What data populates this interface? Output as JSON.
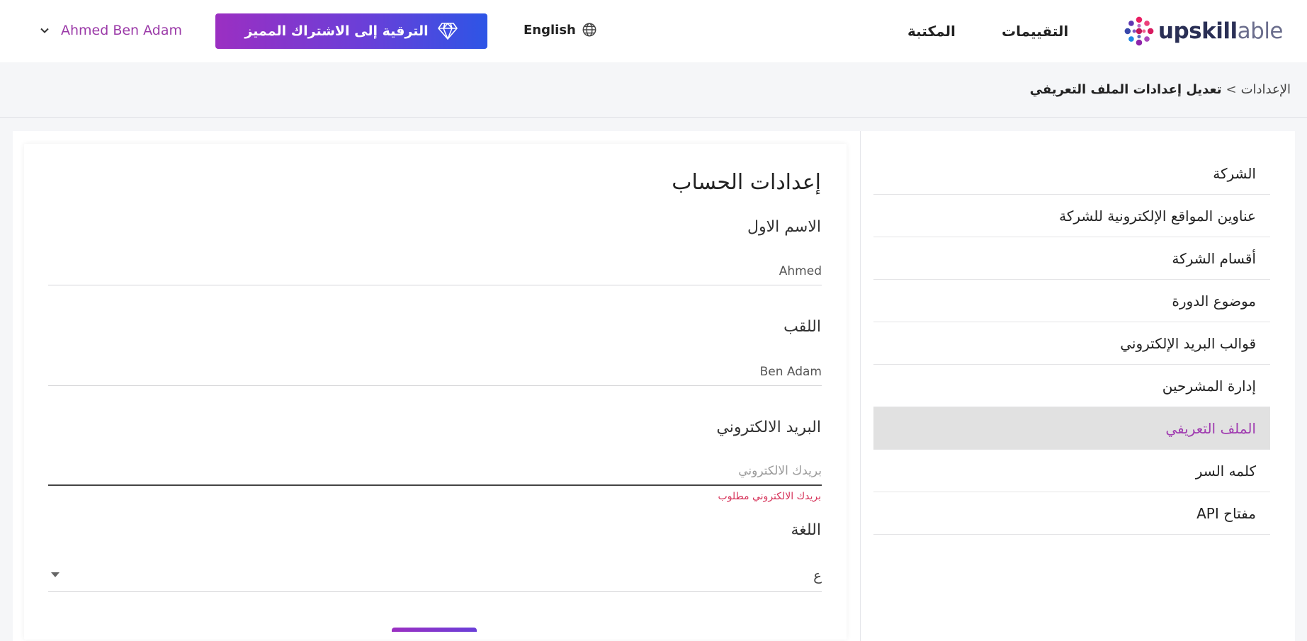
{
  "header": {
    "logo": {
      "text_bold": "upskill",
      "text_light": "able",
      "icon": "upskillable-logo-icon"
    },
    "nav": {
      "assessments": "التقييمات",
      "library": "المكتبة"
    },
    "language_toggle": {
      "label": "English",
      "icon": "globe-icon"
    },
    "upgrade_button": {
      "label": "الترقية إلى الاشتراك المميز",
      "icon": "diamond-icon"
    },
    "user": {
      "name": "Ahmed Ben Adam",
      "icon": "chevron-down-icon"
    }
  },
  "breadcrumb": {
    "root": "الإعدادات",
    "separator": ">",
    "current": "تعديل إعدادات الملف التعريفي"
  },
  "sidebar": {
    "items": [
      {
        "label": "الشركة",
        "active": false
      },
      {
        "label": "عناوين المواقع الإلكترونية للشركة",
        "active": false
      },
      {
        "label": "أقسام الشركة",
        "active": false
      },
      {
        "label": "موضوع الدورة",
        "active": false
      },
      {
        "label": "قوالب البريد الإلكتروني",
        "active": false
      },
      {
        "label": "إدارة المشرحين",
        "active": false
      },
      {
        "label": "الملف التعريفي",
        "active": true
      },
      {
        "label": "كلمه السر",
        "active": false
      },
      {
        "label": "مفتاح API",
        "active": false
      }
    ]
  },
  "form": {
    "title": "إعدادات الحساب",
    "first_name": {
      "label": "الاسم الاول",
      "value": "Ahmed"
    },
    "last_name": {
      "label": "اللقب",
      "value": "Ben Adam"
    },
    "email": {
      "label": "البريد الالكتروني",
      "value": "",
      "placeholder": "بريدك الالكتروني",
      "error": "بريدك الالكتروني مطلوب"
    },
    "language": {
      "label": "اللغة",
      "value": "ع"
    }
  },
  "colors": {
    "accent": "#a03cb0",
    "gradient_start": "#9b2fc2",
    "gradient_end": "#2d55e6",
    "error": "#d6335a"
  }
}
